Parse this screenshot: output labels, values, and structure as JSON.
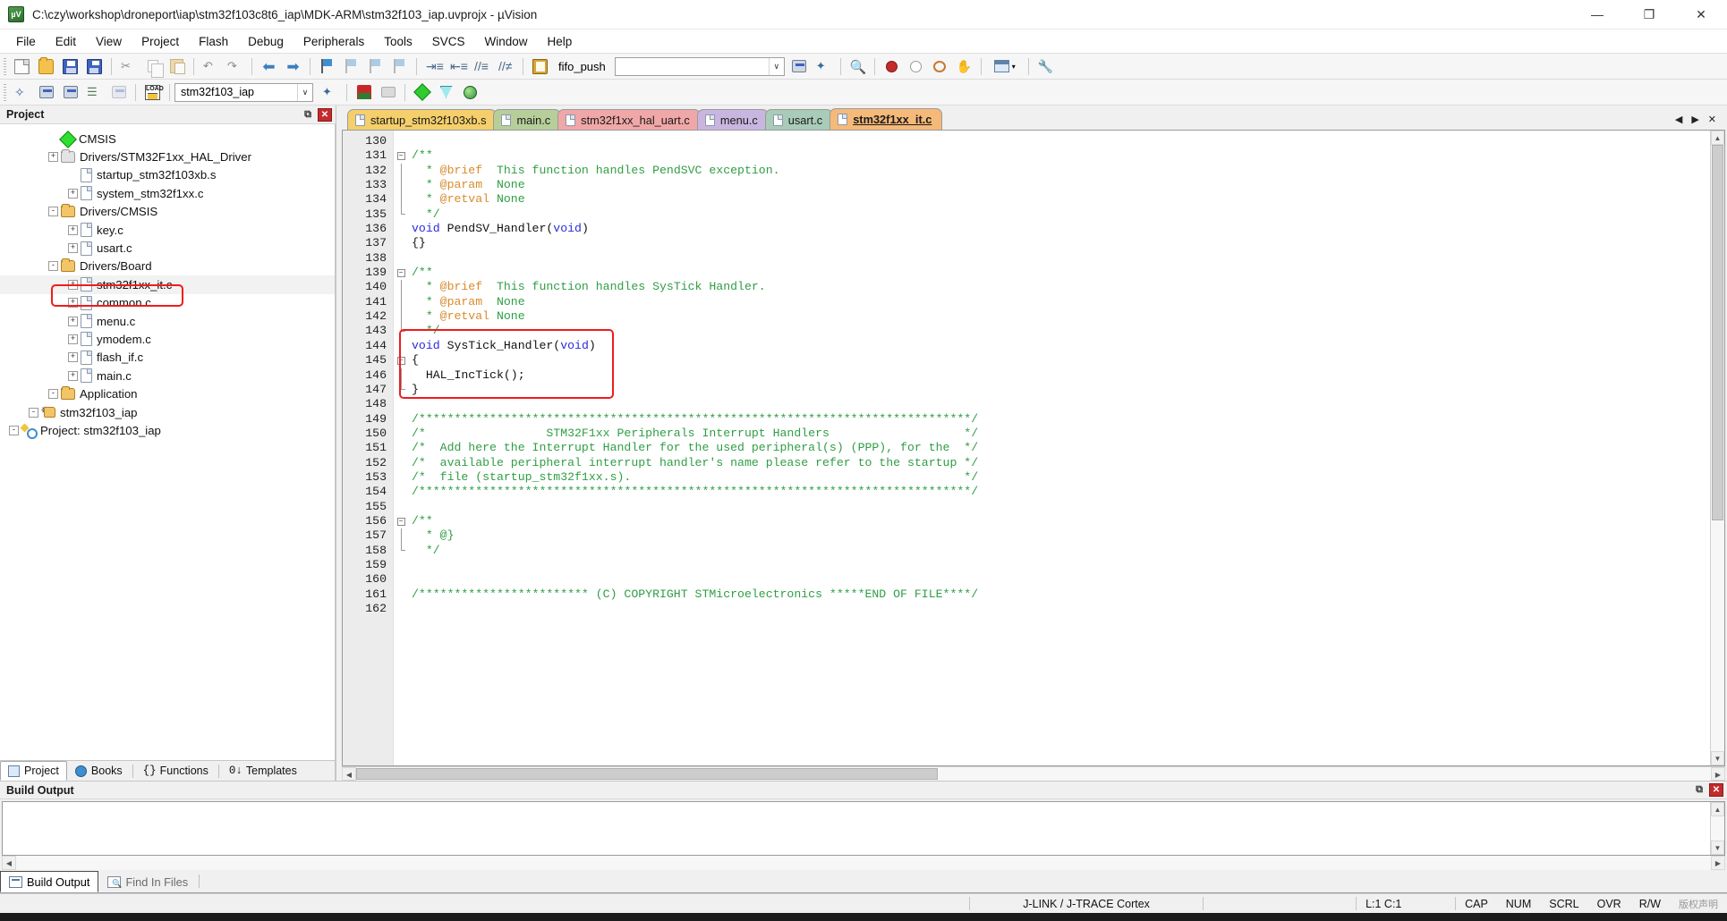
{
  "window": {
    "title": "C:\\czy\\workshop\\droneport\\iap\\stm32f103c8t6_iap\\MDK-ARM\\stm32f103_iap.uvprojx - µVision",
    "app_icon": "uvision-logo-icon",
    "minimize": "—",
    "maximize": "❐",
    "close": "✕"
  },
  "menu": [
    "File",
    "Edit",
    "View",
    "Project",
    "Flash",
    "Debug",
    "Peripherals",
    "Tools",
    "SVCS",
    "Window",
    "Help"
  ],
  "toolbar1": {
    "buttons": [
      {
        "name": "new-file-icon",
        "kind": "page"
      },
      {
        "name": "open-file-icon",
        "kind": "folder"
      },
      {
        "name": "save-icon",
        "kind": "save"
      },
      {
        "name": "save-all-icon",
        "kind": "saveall"
      },
      {
        "name": "cut-icon",
        "kind": "cut"
      },
      {
        "name": "copy-icon",
        "kind": "copy"
      },
      {
        "name": "paste-icon",
        "kind": "paste"
      },
      {
        "name": "undo-icon",
        "kind": "undo"
      },
      {
        "name": "redo-icon",
        "kind": "redo"
      },
      {
        "name": "navigate-backward-icon",
        "kind": "arrow-l"
      },
      {
        "name": "navigate-forward-icon",
        "kind": "arrow-r"
      },
      {
        "name": "toggle-bookmark-icon",
        "kind": "flag"
      },
      {
        "name": "previous-bookmark-icon",
        "kind": "flag-dim"
      },
      {
        "name": "next-bookmark-icon",
        "kind": "flag-dim"
      },
      {
        "name": "clear-bookmarks-icon",
        "kind": "flag-dim"
      },
      {
        "name": "indent-right-icon",
        "kind": "indent"
      },
      {
        "name": "indent-left-icon",
        "kind": "indent"
      },
      {
        "name": "comment-block-icon",
        "kind": "indent"
      },
      {
        "name": "uncomment-block-icon",
        "kind": "indent"
      },
      {
        "name": "function-browser-icon",
        "kind": "book"
      }
    ],
    "symbol_value": "fifo_push",
    "symbol_caret": "∨",
    "after_combo": [
      {
        "name": "find-in-files-icon",
        "kind": "build"
      },
      {
        "name": "incremental-find-icon",
        "kind": "magic"
      },
      {
        "name": "find-icon",
        "kind": "magnify"
      },
      {
        "name": "insert-breakpoint-icon",
        "kind": "dot-red"
      },
      {
        "name": "disable-breakpoint-icon",
        "kind": "dot-hollow"
      },
      {
        "name": "disable-all-breakpoints-icon",
        "kind": "ring"
      },
      {
        "name": "kill-all-breakpoints-icon",
        "kind": "hand"
      },
      {
        "name": "window-layout-icon",
        "kind": "win"
      },
      {
        "name": "configuration-wizard-icon",
        "kind": "wrench"
      }
    ]
  },
  "toolbar2": {
    "buttons": [
      {
        "name": "translate-icon",
        "kind": "diamond-blue"
      },
      {
        "name": "build-icon",
        "kind": "build-grid"
      },
      {
        "name": "rebuild-icon",
        "kind": "build-grid"
      },
      {
        "name": "batch-build-icon",
        "kind": "stack"
      },
      {
        "name": "stop-build-icon",
        "kind": "build-grid-dim"
      },
      {
        "name": "download-icon",
        "kind": "load"
      }
    ],
    "target_value": "stm32f103_iap",
    "target_caret": "∨",
    "after_combo": [
      {
        "name": "target-options-icon",
        "kind": "magic"
      },
      {
        "name": "manage-project-items-icon",
        "kind": "target"
      },
      {
        "name": "multi-project-icon",
        "kind": "printer"
      },
      {
        "name": "pack-installer-icon",
        "kind": "diamond-green"
      },
      {
        "name": "manage-run-time-icon",
        "kind": "diamond-cyan"
      },
      {
        "name": "pack-globe-icon",
        "kind": "globe"
      }
    ]
  },
  "project_pane": {
    "title": "Project",
    "pin": "⧉",
    "close": "✕",
    "tree": [
      {
        "label": "Project: stm32f103_iap",
        "depth": 0,
        "toggle": "-",
        "icon": "project-icon"
      },
      {
        "label": "stm32f103_iap",
        "depth": 1,
        "toggle": "-",
        "icon": "target-icon"
      },
      {
        "label": "Application",
        "depth": 2,
        "toggle": "-",
        "icon": "folder-icon"
      },
      {
        "label": "main.c",
        "depth": 3,
        "toggle": "+",
        "icon": "file-icon"
      },
      {
        "label": "flash_if.c",
        "depth": 3,
        "toggle": "+",
        "icon": "file-icon"
      },
      {
        "label": "ymodem.c",
        "depth": 3,
        "toggle": "+",
        "icon": "file-icon"
      },
      {
        "label": "menu.c",
        "depth": 3,
        "toggle": "+",
        "icon": "file-icon"
      },
      {
        "label": "common.c",
        "depth": 3,
        "toggle": "+",
        "icon": "file-icon"
      },
      {
        "label": "stm32f1xx_it.c",
        "depth": 3,
        "toggle": "+",
        "icon": "file-icon",
        "selected": true,
        "highlighted": true
      },
      {
        "label": "Drivers/Board",
        "depth": 2,
        "toggle": "-",
        "icon": "folder-icon"
      },
      {
        "label": "usart.c",
        "depth": 3,
        "toggle": "+",
        "icon": "file-icon"
      },
      {
        "label": "key.c",
        "depth": 3,
        "toggle": "+",
        "icon": "file-icon"
      },
      {
        "label": "Drivers/CMSIS",
        "depth": 2,
        "toggle": "-",
        "icon": "folder-icon"
      },
      {
        "label": "system_stm32f1xx.c",
        "depth": 3,
        "toggle": "+",
        "icon": "file-icon"
      },
      {
        "label": "startup_stm32f103xb.s",
        "depth": 3,
        "toggle": "",
        "icon": "file-icon"
      },
      {
        "label": "Drivers/STM32F1xx_HAL_Driver",
        "depth": 2,
        "toggle": "+",
        "icon": "folder-grey-icon"
      },
      {
        "label": "CMSIS",
        "depth": 2,
        "toggle": "",
        "icon": "cmsis-icon"
      }
    ],
    "tabs": [
      {
        "label": "Project",
        "icon": "project-window-icon",
        "active": true
      },
      {
        "label": "Books",
        "icon": "books-icon",
        "active": false
      },
      {
        "label": "Functions",
        "icon": "functions-icon",
        "active": false
      },
      {
        "label": "Templates",
        "icon": "templates-icon",
        "active": false
      }
    ]
  },
  "editor": {
    "tabs": [
      {
        "label": "startup_stm32f103xb.s",
        "color": "#f5cf6b",
        "active": false
      },
      {
        "label": "main.c",
        "color": "#b6cf9a",
        "active": false
      },
      {
        "label": "stm32f1xx_hal_uart.c",
        "color": "#f0a7a7",
        "active": false
      },
      {
        "label": "menu.c",
        "color": "#c9b6e0",
        "active": false
      },
      {
        "label": "usart.c",
        "color": "#a8ccb8",
        "active": false
      },
      {
        "label": "stm32f1xx_it.c",
        "color": "#f5b97a",
        "active": true
      }
    ],
    "tab_controls": {
      "prev": "◀",
      "next": "▶",
      "close": "✕"
    },
    "first_line": 130,
    "lines": [
      {
        "n": 130,
        "fold": "",
        "segs": []
      },
      {
        "n": 131,
        "fold": "minus",
        "segs": [
          {
            "t": "/**",
            "c": "cm"
          }
        ]
      },
      {
        "n": 132,
        "fold": "bar",
        "segs": [
          {
            "t": "  * ",
            "c": "cm"
          },
          {
            "t": "@brief",
            "c": "tag"
          },
          {
            "t": "  This function handles PendSVC exception.",
            "c": "cm"
          }
        ]
      },
      {
        "n": 133,
        "fold": "bar",
        "segs": [
          {
            "t": "  * ",
            "c": "cm"
          },
          {
            "t": "@param",
            "c": "tag"
          },
          {
            "t": "  None",
            "c": "cm"
          }
        ]
      },
      {
        "n": 134,
        "fold": "bar",
        "segs": [
          {
            "t": "  * ",
            "c": "cm"
          },
          {
            "t": "@retval",
            "c": "tag"
          },
          {
            "t": " None",
            "c": "cm"
          }
        ]
      },
      {
        "n": 135,
        "fold": "end",
        "segs": [
          {
            "t": "  */",
            "c": "cm"
          }
        ]
      },
      {
        "n": 136,
        "fold": "",
        "segs": [
          {
            "t": "void",
            "c": "kw"
          },
          {
            "t": " PendSV_Handler(",
            "c": "pl"
          },
          {
            "t": "void",
            "c": "kw"
          },
          {
            "t": ")",
            "c": "pl"
          }
        ]
      },
      {
        "n": 137,
        "fold": "",
        "segs": [
          {
            "t": "{}",
            "c": "pl"
          }
        ]
      },
      {
        "n": 138,
        "fold": "",
        "segs": []
      },
      {
        "n": 139,
        "fold": "minus",
        "segs": [
          {
            "t": "/**",
            "c": "cm"
          }
        ]
      },
      {
        "n": 140,
        "fold": "bar",
        "segs": [
          {
            "t": "  * ",
            "c": "cm"
          },
          {
            "t": "@brief",
            "c": "tag"
          },
          {
            "t": "  This function handles SysTick Handler.",
            "c": "cm"
          }
        ]
      },
      {
        "n": 141,
        "fold": "bar",
        "segs": [
          {
            "t": "  * ",
            "c": "cm"
          },
          {
            "t": "@param",
            "c": "tag"
          },
          {
            "t": "  None",
            "c": "cm"
          }
        ]
      },
      {
        "n": 142,
        "fold": "bar",
        "segs": [
          {
            "t": "  * ",
            "c": "cm"
          },
          {
            "t": "@retval",
            "c": "tag"
          },
          {
            "t": " None",
            "c": "cm"
          }
        ]
      },
      {
        "n": 143,
        "fold": "end",
        "segs": [
          {
            "t": "  */",
            "c": "cm"
          }
        ]
      },
      {
        "n": 144,
        "fold": "",
        "segs": [
          {
            "t": "void",
            "c": "kw"
          },
          {
            "t": " SysTick_Handler(",
            "c": "pl"
          },
          {
            "t": "void",
            "c": "kw"
          },
          {
            "t": ")",
            "c": "pl"
          }
        ]
      },
      {
        "n": 145,
        "fold": "minus",
        "segs": [
          {
            "t": "{",
            "c": "pl"
          }
        ]
      },
      {
        "n": 146,
        "fold": "bar",
        "segs": [
          {
            "t": "  HAL_IncTick();",
            "c": "pl"
          }
        ]
      },
      {
        "n": 147,
        "fold": "end",
        "segs": [
          {
            "t": "}",
            "c": "pl"
          }
        ]
      },
      {
        "n": 148,
        "fold": "",
        "segs": []
      },
      {
        "n": 149,
        "fold": "",
        "segs": [
          {
            "t": "/******************************************************************************/",
            "c": "cm"
          }
        ]
      },
      {
        "n": 150,
        "fold": "",
        "segs": [
          {
            "t": "/*                 STM32F1xx Peripherals Interrupt Handlers                   */",
            "c": "cm"
          }
        ]
      },
      {
        "n": 151,
        "fold": "",
        "segs": [
          {
            "t": "/*  Add here the Interrupt Handler for the used peripheral(s) (PPP), for the  */",
            "c": "cm"
          }
        ]
      },
      {
        "n": 152,
        "fold": "",
        "segs": [
          {
            "t": "/*  available peripheral interrupt handler's name please refer to the startup */",
            "c": "cm"
          }
        ]
      },
      {
        "n": 153,
        "fold": "",
        "segs": [
          {
            "t": "/*  file (startup_stm32f1xx.s).                                               */",
            "c": "cm"
          }
        ]
      },
      {
        "n": 154,
        "fold": "",
        "segs": [
          {
            "t": "/******************************************************************************/",
            "c": "cm"
          }
        ]
      },
      {
        "n": 155,
        "fold": "",
        "segs": []
      },
      {
        "n": 156,
        "fold": "minus",
        "segs": [
          {
            "t": "/**",
            "c": "cm"
          }
        ]
      },
      {
        "n": 157,
        "fold": "bar",
        "segs": [
          {
            "t": "  * @}",
            "c": "cm"
          }
        ]
      },
      {
        "n": 158,
        "fold": "end",
        "segs": [
          {
            "t": "  */",
            "c": "cm"
          }
        ]
      },
      {
        "n": 159,
        "fold": "",
        "segs": []
      },
      {
        "n": 160,
        "fold": "",
        "segs": []
      },
      {
        "n": 161,
        "fold": "",
        "segs": [
          {
            "t": "/************************ (C) COPYRIGHT STMicroelectronics *****END OF FILE****/",
            "c": "cm"
          }
        ]
      },
      {
        "n": 162,
        "fold": "",
        "segs": []
      }
    ]
  },
  "build_output": {
    "title": "Build Output",
    "pin": "⧉",
    "close": "✕",
    "text": "",
    "tabs": [
      {
        "label": "Build Output",
        "icon": "build-output-icon",
        "active": true
      },
      {
        "label": "Find In Files",
        "icon": "find-in-files-icon",
        "active": false
      }
    ]
  },
  "status": {
    "left": "",
    "debugger": "J-LINK / J-TRACE Cortex",
    "position": "L:1 C:1",
    "caps": "CAP",
    "num": "NUM",
    "scrl": "SCRL",
    "ovr": "OVR",
    "rw": "R/W",
    "watermark": "版权声明"
  },
  "colors": {
    "comment_green": "#2f9e44",
    "doc_tag_orange": "#d98a2b",
    "keyword_blue": "#2b2bdd",
    "annotation_red": "#ee1c1c",
    "active_tab_orange": "#f5b97a"
  }
}
